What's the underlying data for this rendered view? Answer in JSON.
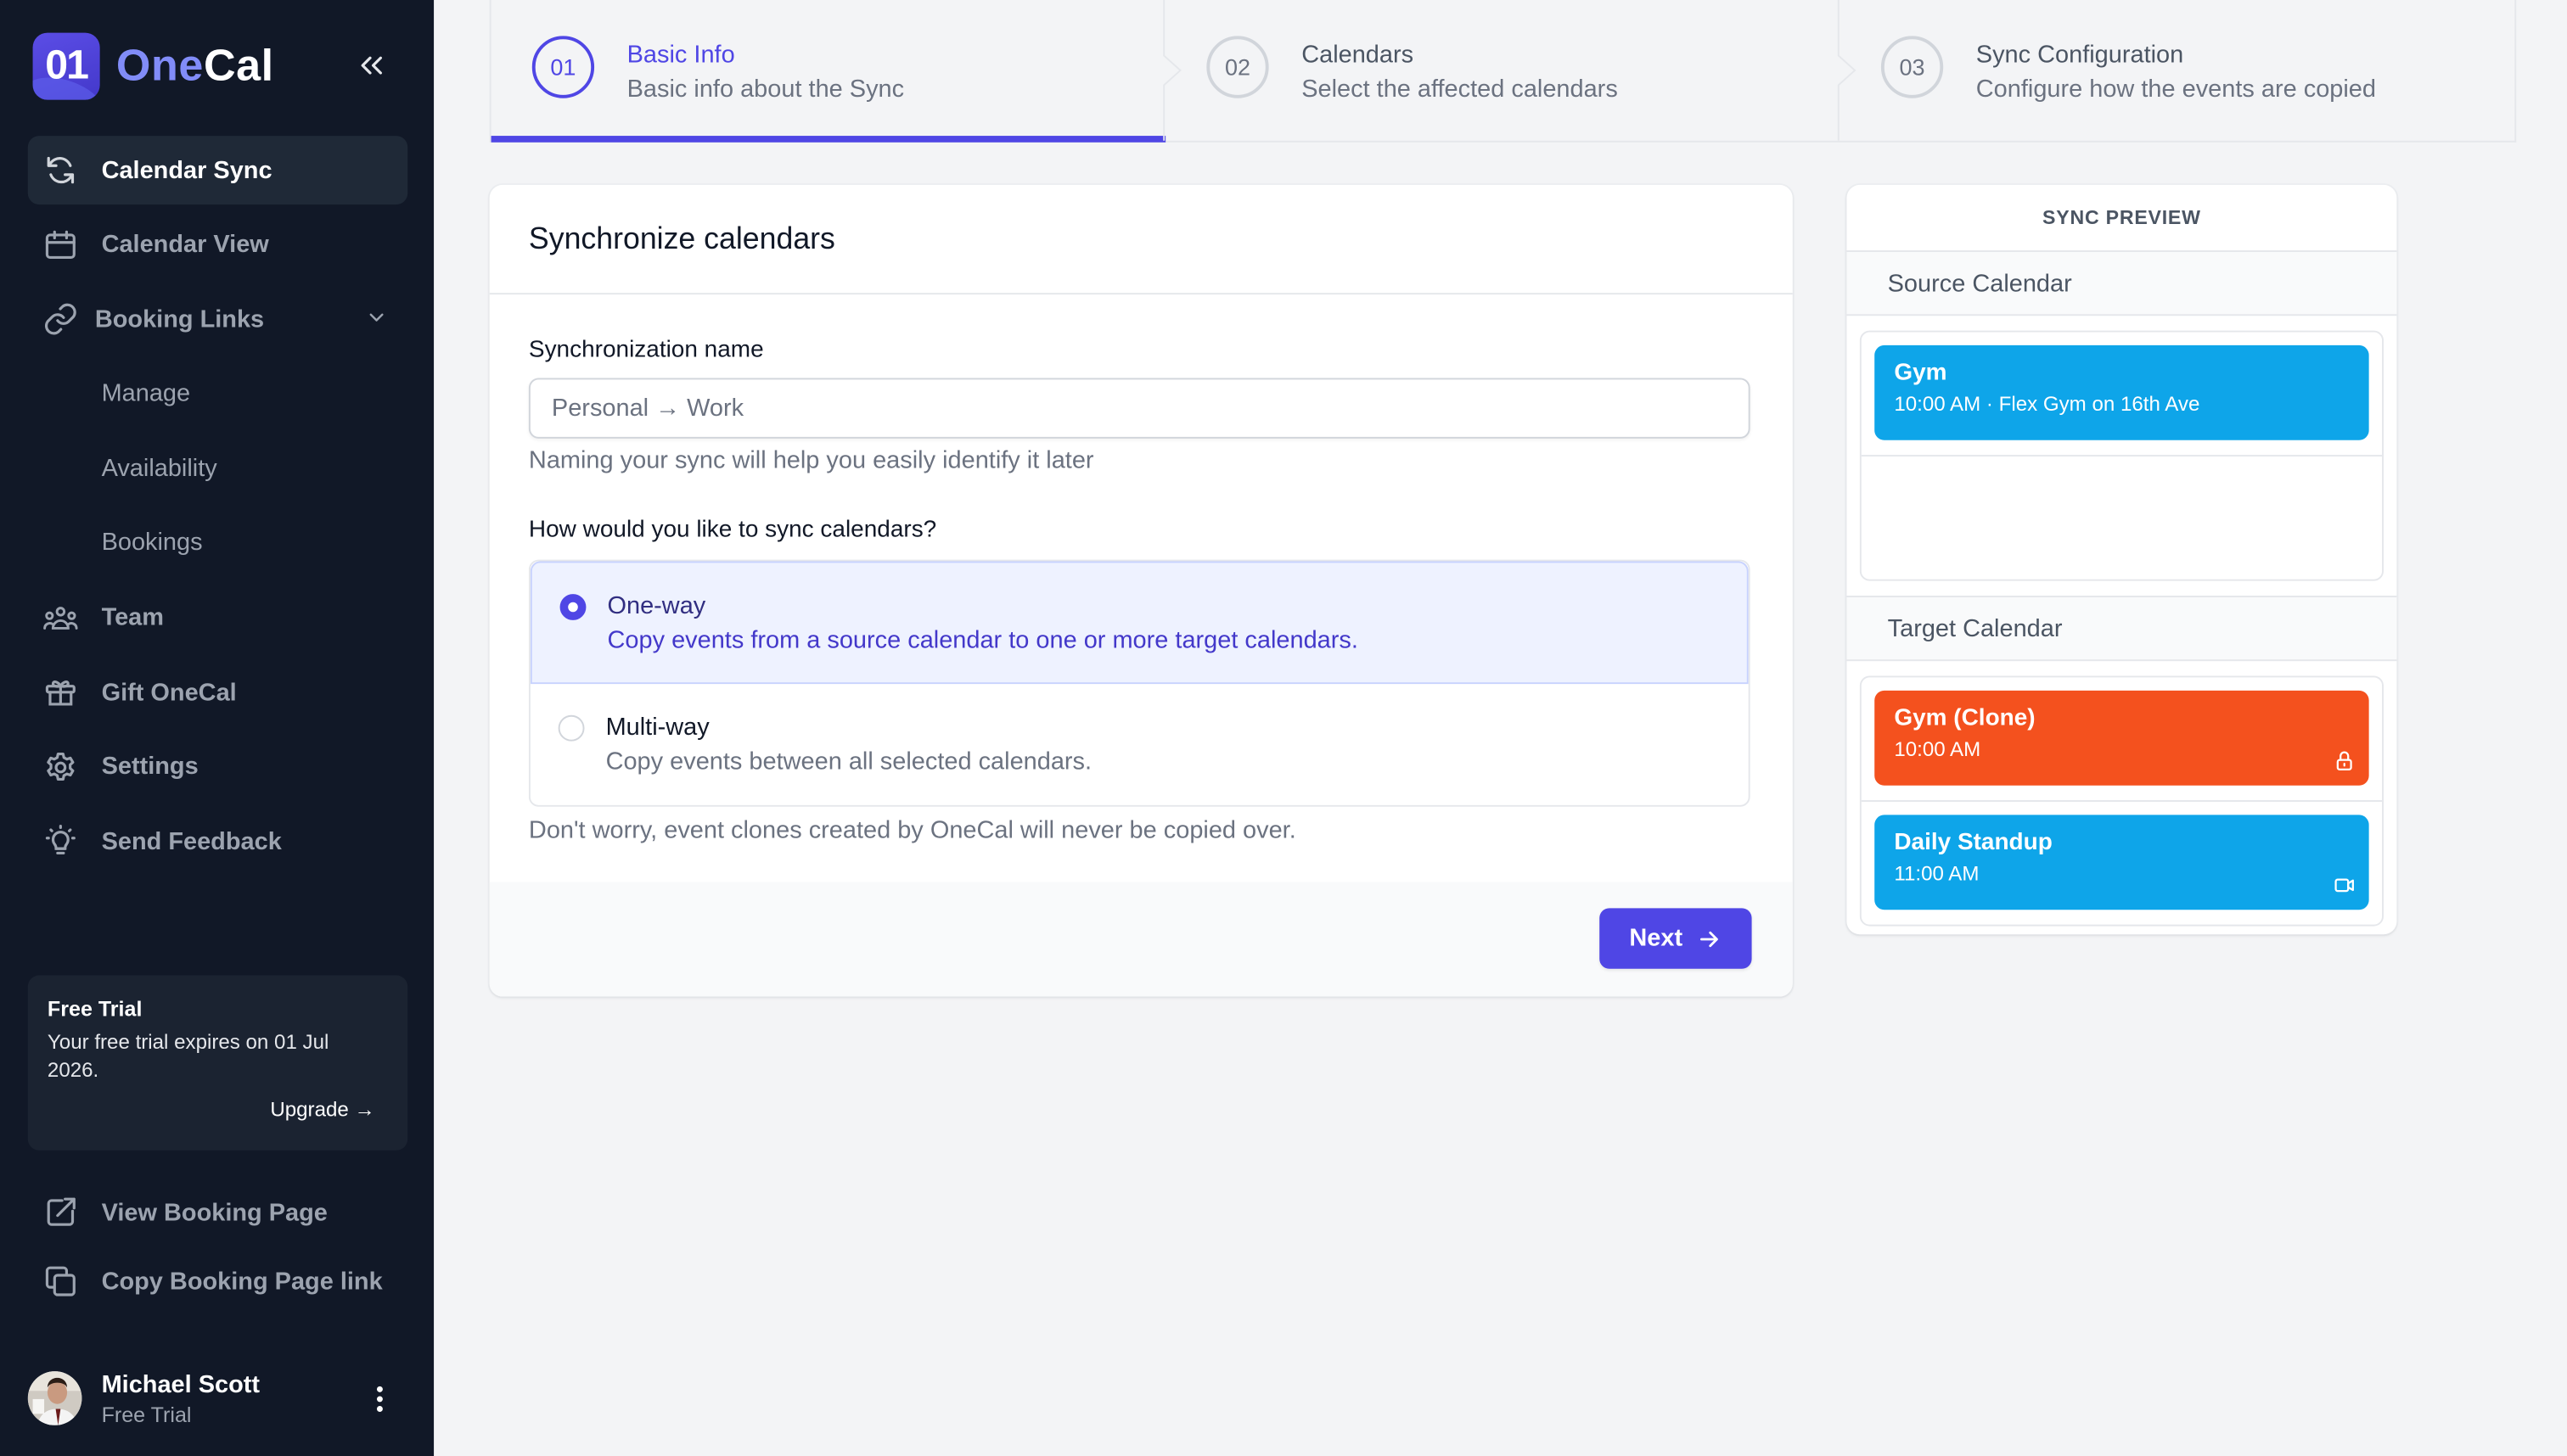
{
  "app": {
    "name_part1": "One",
    "name_part2": "Cal",
    "logo_mark": "01"
  },
  "sidebar": {
    "collapse_icon": "chevrons-left-icon",
    "items": [
      {
        "label": "Calendar Sync",
        "icon": "refresh-icon",
        "active": true
      },
      {
        "label": "Calendar View",
        "icon": "calendar-icon"
      },
      {
        "label": "Booking Links",
        "icon": "link-icon",
        "expanded": true
      },
      {
        "label": "Manage",
        "sub": true
      },
      {
        "label": "Availability",
        "sub": true
      },
      {
        "label": "Bookings",
        "sub": true
      },
      {
        "label": "Team",
        "icon": "users-icon"
      },
      {
        "label": "Gift OneCal",
        "icon": "gift-icon"
      },
      {
        "label": "Settings",
        "icon": "gear-icon"
      },
      {
        "label": "Send Feedback",
        "icon": "lightbulb-icon"
      }
    ],
    "trial": {
      "title": "Free Trial",
      "message": "Your free trial expires on 01 Jul 2026.",
      "upgrade_label": "Upgrade →"
    },
    "bottom_links": [
      {
        "label": "View Booking Page",
        "icon": "external-link-icon"
      },
      {
        "label": "Copy Booking Page link",
        "icon": "copy-icon"
      }
    ],
    "user": {
      "name": "Michael Scott",
      "plan": "Free Trial"
    }
  },
  "stepper": {
    "steps": [
      {
        "number": "01",
        "title": "Basic Info",
        "description": "Basic info about the Sync",
        "active": true
      },
      {
        "number": "02",
        "title": "Calendars",
        "description": "Select the affected calendars"
      },
      {
        "number": "03",
        "title": "Sync Configuration",
        "description": "Configure how the events are copied"
      }
    ]
  },
  "form": {
    "title": "Synchronize calendars",
    "name_label": "Synchronization name",
    "name_value": "",
    "name_placeholder": "Personal → Work",
    "name_help": "Naming your sync will help you easily identify it later",
    "mode_label": "How would you like to sync calendars?",
    "options": [
      {
        "title": "One-way",
        "description": "Copy events from a source calendar to one or more target calendars.",
        "selected": true
      },
      {
        "title": "Multi-way",
        "description": "Copy events between all selected calendars.",
        "selected": false
      }
    ],
    "note": "Don't worry, event clones created by OneCal will never be copied over.",
    "next_label": "Next"
  },
  "preview": {
    "title": "SYNC PREVIEW",
    "source_label": "Source Calendar",
    "target_label": "Target Calendar",
    "source_events": [
      {
        "title": "Gym",
        "subtitle": "10:00 AM · Flex Gym on 16th Ave",
        "color": "#0ea5e9"
      }
    ],
    "target_events": [
      {
        "title": "Gym (Clone)",
        "subtitle": "10:00 AM",
        "color": "#f4511e",
        "icon": "lock-icon"
      },
      {
        "title": "Daily Standup",
        "subtitle": "11:00 AM",
        "color": "#0ea5e9",
        "icon": "video-icon"
      }
    ]
  },
  "colors": {
    "accent": "#4f46e5",
    "sidebar_bg": "#111827",
    "event_blue": "#0ea5e9",
    "event_orange": "#f4511e"
  }
}
